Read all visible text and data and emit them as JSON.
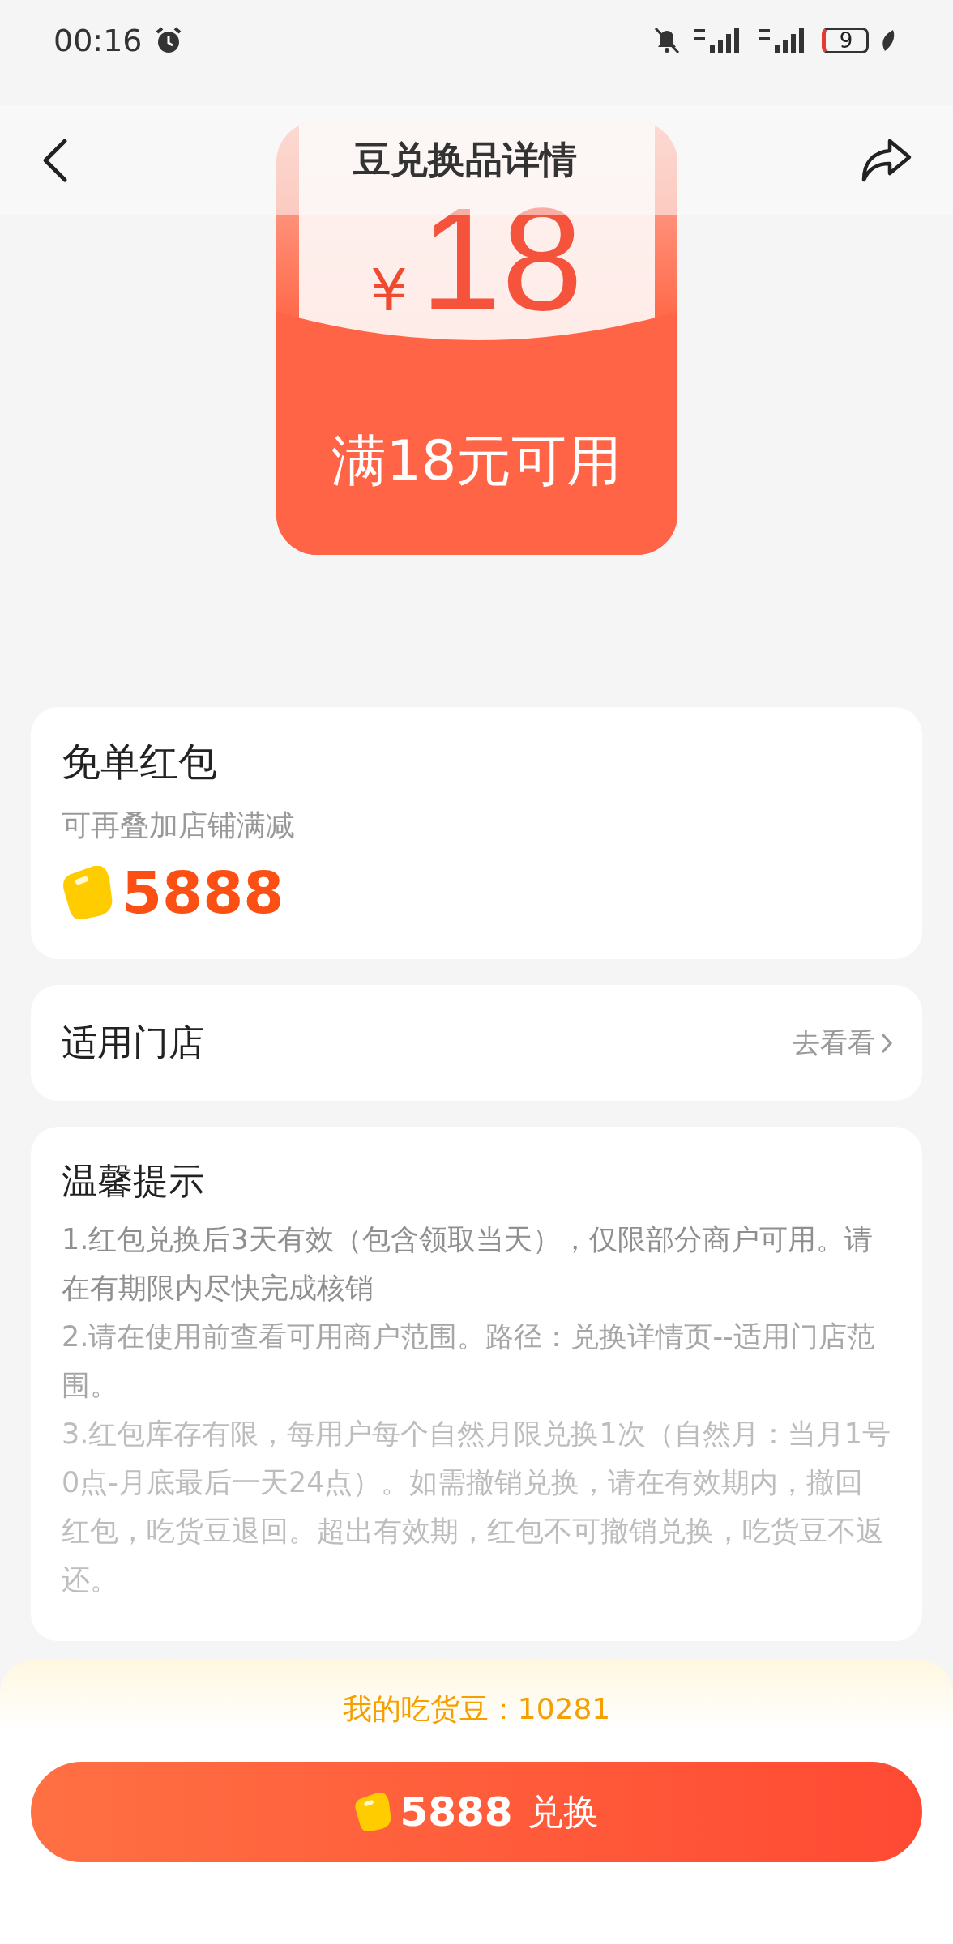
{
  "status_bar": {
    "time": "00:16",
    "battery": "9"
  },
  "header": {
    "title": "豆兑换品详情"
  },
  "coupon": {
    "currency": "¥",
    "amount": "18",
    "condition": "满18元可用"
  },
  "product": {
    "name": "免单红包",
    "subtitle": "可再叠加店铺满减",
    "price": "5888"
  },
  "stores": {
    "label": "适用门店",
    "link": "去看看"
  },
  "tips": {
    "title": "温馨提示",
    "items": [
      "1.红包兑换后3天有效（包含领取当天），仅限部分商户可用。请在有期限内尽快完成核销",
      "2.请在使用前查看可用商户范围。路径：兑换详情页--适用门店范围。",
      "3.红包库存有限，每用户每个自然月限兑换1次（自然月：当月1号0点-月底最后一天24点）。如需撤销兑换，请在有效期内，撤回红包，吃货豆退回。超出有效期，红包不可撤销兑换，吃货豆不返还。"
    ]
  },
  "footer": {
    "balance": "我的吃货豆：10281",
    "button": {
      "price": "5888",
      "label": "兑换"
    }
  }
}
